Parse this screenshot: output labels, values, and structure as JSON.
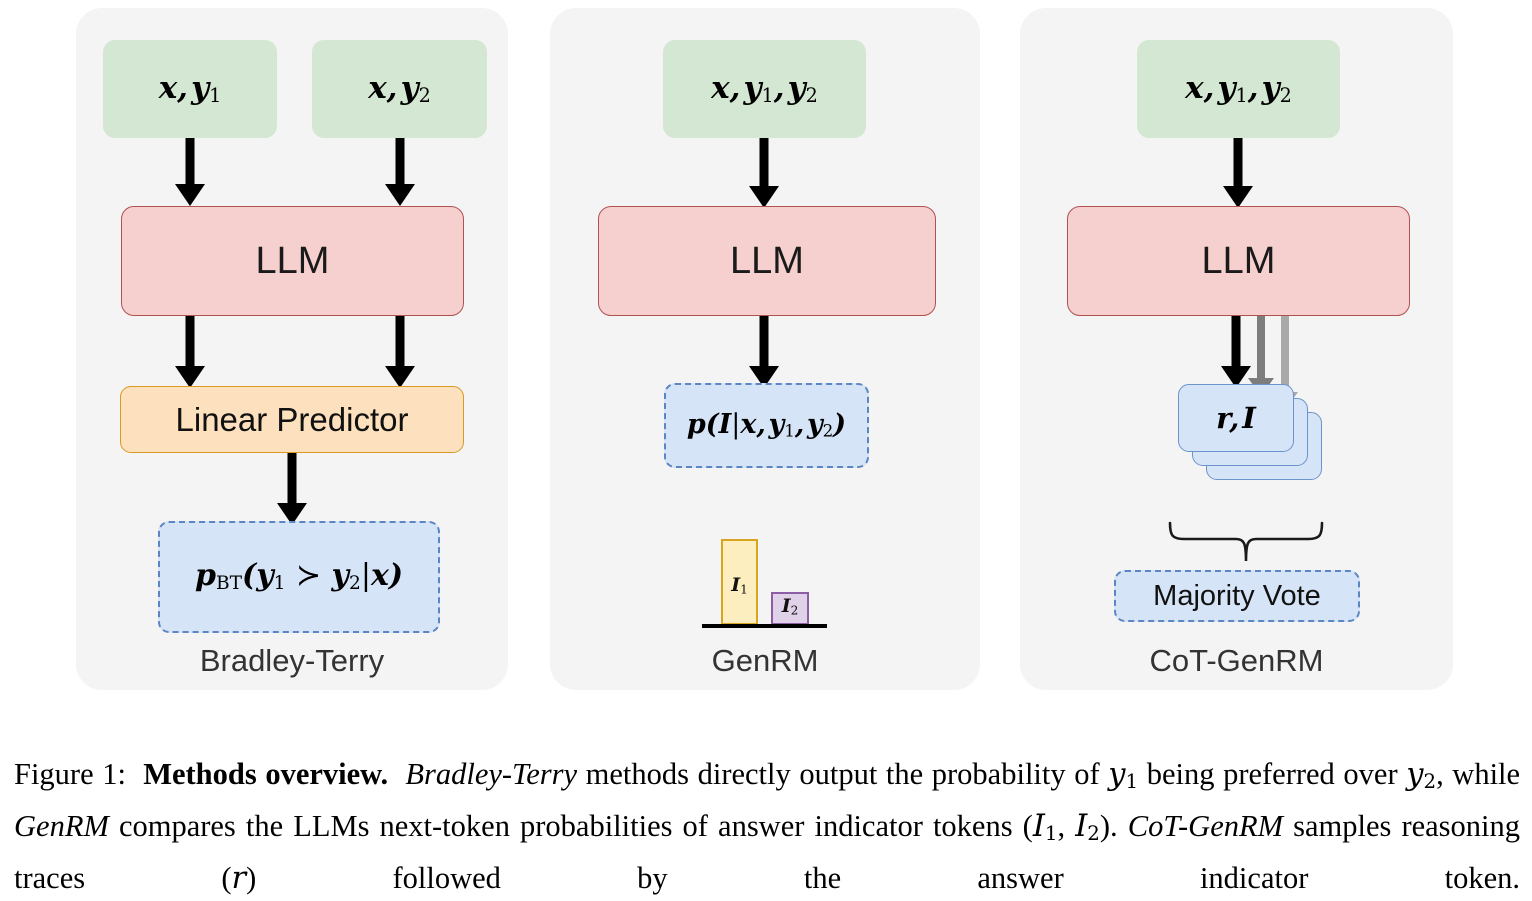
{
  "figure": {
    "panels": [
      {
        "id": "bradley-terry",
        "label": "Bradley-Terry",
        "inputs": [
          {
            "text": "x, y₁",
            "base": "x, y",
            "sub": "1"
          },
          {
            "text": "x, y₂",
            "base": "x, y",
            "sub": "2"
          }
        ],
        "model_label": "LLM",
        "predictor_label": "Linear Predictor",
        "output": {
          "text": "p_BT(y₁ ≻ y₂|x)"
        }
      },
      {
        "id": "genrm",
        "label": "GenRM",
        "inputs": [
          {
            "text": "x, y₁, y₂"
          }
        ],
        "model_label": "LLM",
        "output": {
          "text": "p(I|x, y₁, y₂)"
        },
        "bars": [
          {
            "label": "I₁",
            "base": "I",
            "sub": "1"
          },
          {
            "label": "I₂",
            "base": "I",
            "sub": "2"
          }
        ]
      },
      {
        "id": "cot-genrm",
        "label": "CoT-GenRM",
        "inputs": [
          {
            "text": "x, y₁, y₂"
          }
        ],
        "model_label": "LLM",
        "sample_card": {
          "text": "r, I"
        },
        "aggregate_label": "Majority Vote"
      }
    ],
    "colors": {
      "panel_background": "#f4f4f4",
      "input_box": "#d4e7d2",
      "llm_box_fill": "#f6cfcf",
      "llm_box_border": "#b05252",
      "predictor_fill": "#fde0bd",
      "predictor_border": "#d79a22",
      "output_fill": "#d6e4f7",
      "output_border": "#5b85c4",
      "bar_1_fill": "#fdeec0",
      "bar_1_border": "#d9a521",
      "bar_2_fill": "#e0d2e8",
      "bar_2_border": "#8c5fa5",
      "arrow_black": "#000000",
      "arrow_gray": "#7d7d7d",
      "label_text": "#333333"
    }
  },
  "chart_data": {
    "type": "bar",
    "title": "",
    "categories": [
      "I₁",
      "I₂"
    ],
    "values": [
      1.0,
      0.39
    ],
    "xlabel": "",
    "ylabel": "",
    "ylim": [
      0,
      1.1
    ],
    "grid": false,
    "legend": "none",
    "annotations": [
      "Next-token probabilities of answer indicator tokens"
    ]
  },
  "caption": {
    "figure_number": "Figure 1:",
    "title": "Methods overview.",
    "line1_a": "Bradley-Terry",
    "line1_b": "methods directly output the probability of",
    "line1_var": "y",
    "line1_var_sub": "1",
    "line1_c": "being",
    "line2_a": "preferred over",
    "line2_var": "y",
    "line2_var_sub": "2",
    "line2_b": ", while",
    "line2_c": "GenRM",
    "line2_d": "compares the LLMs next-token probabilities of answer indicator",
    "line3_a": "tokens (",
    "line3_v1": "I",
    "line3_v1_sub": "1",
    "line3_sep": ",",
    "line3_v2": "I",
    "line3_v2_sub": "2",
    "line3_b": ").",
    "line3_c": "CoT-GenRM",
    "line3_d": "samples reasoning traces (",
    "line3_v3": "r",
    "line3_e": ") followed by the answer indicator token."
  }
}
